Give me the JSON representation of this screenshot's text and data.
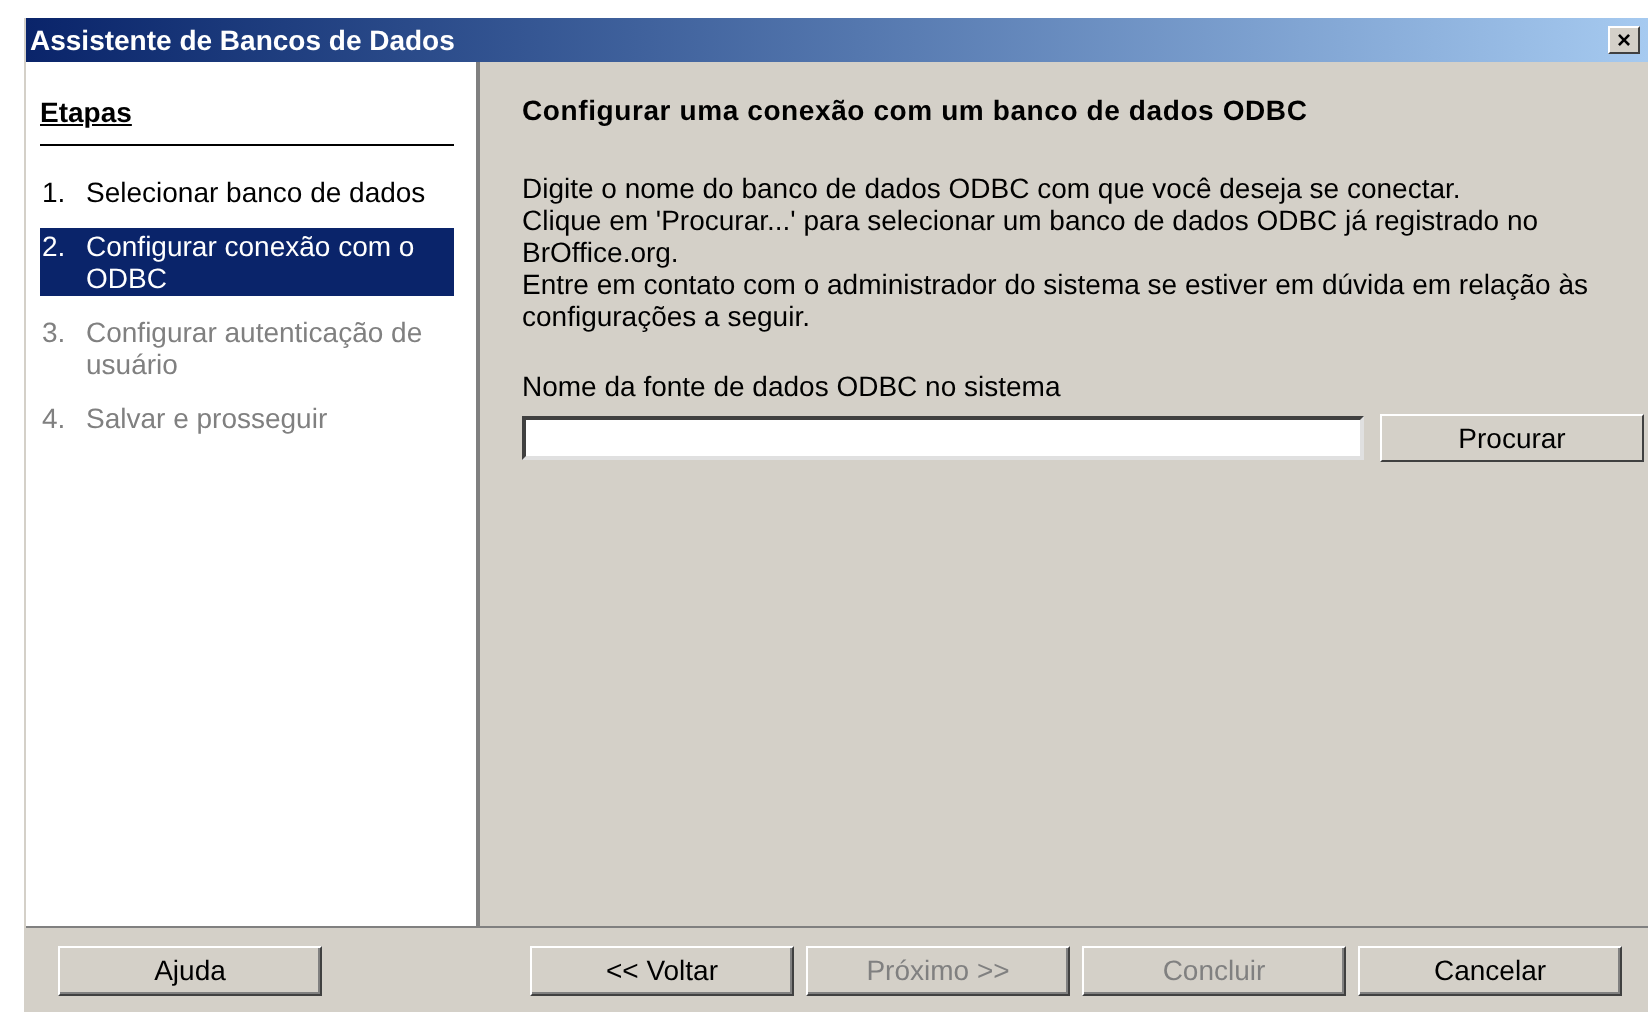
{
  "window": {
    "title": "Assistente de Bancos de Dados",
    "close": "×"
  },
  "steps_heading": "Etapas",
  "steps": [
    {
      "number": "1.",
      "label": "Selecionar banco de dados",
      "selected": false,
      "disabled": false
    },
    {
      "number": "2.",
      "label": "Configurar conexão com o ODBC",
      "selected": true,
      "disabled": false
    },
    {
      "number": "3.",
      "label": "Configurar autenticação de usuário",
      "selected": false,
      "disabled": true
    },
    {
      "number": "4.",
      "label": "Salvar e prosseguir",
      "selected": false,
      "disabled": true
    }
  ],
  "page": {
    "heading": "Configurar uma conexão com um banco de dados ODBC",
    "paragraphs": [
      "Digite o nome do banco de dados ODBC com que você deseja se conectar.",
      "Clique em 'Procurar...' para selecionar um banco de dados ODBC já registrado no BrOffice.org.",
      "Entre em contato com o administrador do sistema se estiver em dúvida em relação às configurações a seguir."
    ],
    "field_label": "Nome da fonte de dados ODBC no sistema",
    "browse_button": "Procurar"
  },
  "buttons": [
    {
      "label": "Ajuda",
      "disabled": false
    },
    {
      "label": "<< Voltar",
      "disabled": false
    },
    {
      "label": "Próximo >>",
      "disabled": true
    },
    {
      "label": "Concluir",
      "disabled": true
    },
    {
      "label": "Cancelar",
      "disabled": false
    }
  ]
}
